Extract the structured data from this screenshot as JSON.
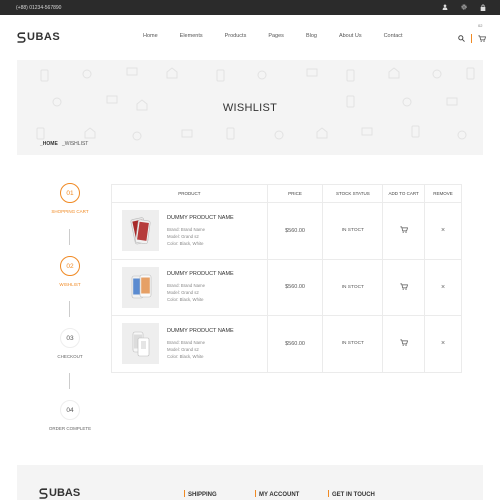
{
  "topbar": {
    "phone": "(+88) 01234-567890",
    "icons": [
      "user-icon",
      "gear-icon",
      "lock-icon"
    ]
  },
  "header": {
    "logo": "UBAS",
    "nav": [
      "Home",
      "Elements",
      "Products",
      "Pages",
      "Blog",
      "About Us",
      "Contact"
    ],
    "cart_count": "02"
  },
  "banner": {
    "title": "WISHLIST",
    "crumb_home": "_HOME",
    "crumb_current": "_WISHLIST"
  },
  "steps": [
    {
      "num": "01",
      "label": "SHOPPING CART",
      "active": true
    },
    {
      "num": "02",
      "label": "WISHLIST",
      "active": true
    },
    {
      "num": "03",
      "label": "CHECKOUT",
      "active": false
    },
    {
      "num": "04",
      "label": "ORDER COMPLETE",
      "active": false
    }
  ],
  "table": {
    "headers": [
      "PRODUCT",
      "PRICE",
      "STOCK STATUS",
      "ADD TO CART",
      "REMOVE"
    ],
    "rows": [
      {
        "name": "DUMMY PRODUCT NAME",
        "brand": "Brand: Brand Name",
        "model": "Model: Grand s2",
        "color": "Color: Black, White",
        "price": "$560.00",
        "stock": "IN STOCT"
      },
      {
        "name": "DUMMY PRODUCT NAME",
        "brand": "Brand: Brand Name",
        "model": "Model: Grand s2",
        "color": "Color: Black, White",
        "price": "$560.00",
        "stock": "IN STOCT"
      },
      {
        "name": "DUMMY PRODUCT NAME",
        "brand": "Brand: Brand Name",
        "model": "Model: Grand s2",
        "color": "Color: Black, White",
        "price": "$560.00",
        "stock": "IN STOCT"
      }
    ],
    "remove_glyph": "×"
  },
  "footer": {
    "logo": "UBAS",
    "headings": [
      "SHIPPING",
      "MY ACCOUNT",
      "GET IN TOUCH"
    ]
  },
  "colors": {
    "accent": "#f08a24",
    "topbar": "#2b2b2b",
    "banner": "#f4f4f4"
  }
}
